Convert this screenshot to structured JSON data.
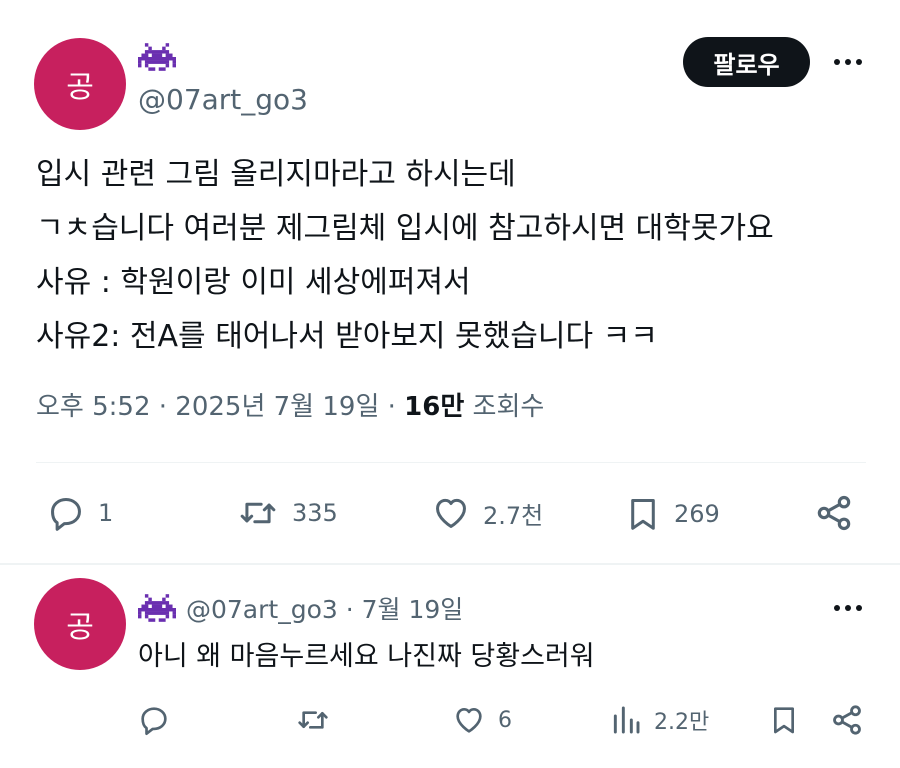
{
  "tweet": {
    "avatar_text": "공",
    "handle": "@07art_go3",
    "follow_label": "팔로우",
    "lines": [
      "입시 관련 그림 올리지마라고 하시는데",
      "ㄱㅊ습니다 여러분 제그림체 입시에 참고하시면 대학못가요",
      "사유 : 학원이랑 이미 세상에퍼져서",
      "사유2: 전A를 태어나서 받아보지 못했습니다 ㅋㅋ"
    ],
    "time": "오후 5:52 · 2025년 7월 19일 · ",
    "views_count": "16만",
    "views_label": " 조회수",
    "actions": {
      "reply_count": "1",
      "retweet_count": "335",
      "like_count": "2.7천",
      "bookmark_count": "269"
    }
  },
  "reply": {
    "avatar_text": "공",
    "header": "@07art_go3 · 7월 19일",
    "text": "아니 왜 마음누르세요 나진짜 당황스러워",
    "actions": {
      "reply_count": "",
      "retweet_count": "",
      "like_count": "6",
      "views_count": "2.2만"
    }
  },
  "colors": {
    "avatar": "#c7205e",
    "text": "#0f1419",
    "secondary": "#536471",
    "divider": "#eff3f4",
    "name_icon": "#6a2fb0"
  },
  "icons": [
    "space-invader-icon",
    "more-icon",
    "reply-icon",
    "retweet-icon",
    "like-icon",
    "bookmark-icon",
    "share-icon",
    "views-icon"
  ]
}
